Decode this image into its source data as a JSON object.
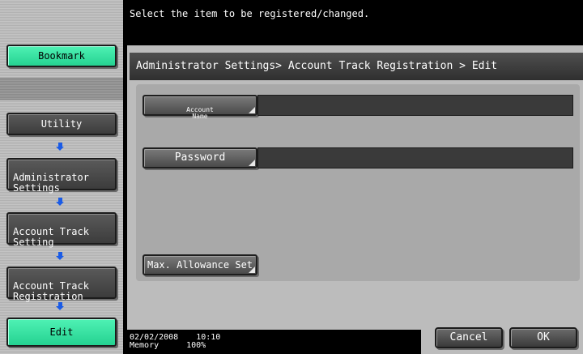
{
  "top_message": "Select the item to be registered/changed.",
  "breadcrumb": "Administrator Settings> Account Track Registration > Edit",
  "sidebar": {
    "bookmark": "Bookmark",
    "utility": "Utility",
    "administrator_settings": "Administrator\nSettings",
    "account_track_setting": "Account Track\nSetting",
    "account_track_registration": "Account Track\nRegistration",
    "edit": "Edit"
  },
  "form": {
    "account_name_label": "Account\nName",
    "account_name_value": "",
    "password_label": "Password",
    "password_value": "",
    "max_allowance_label": "Max. Allowance Set"
  },
  "status": {
    "date": "02/02/2008",
    "time": "10:10",
    "memory_label": "Memory",
    "memory_value": "100%"
  },
  "actions": {
    "cancel": "Cancel",
    "ok": "OK"
  },
  "colors": {
    "accent_green": "#37e3a0",
    "arrow_blue": "#1a5be6"
  }
}
